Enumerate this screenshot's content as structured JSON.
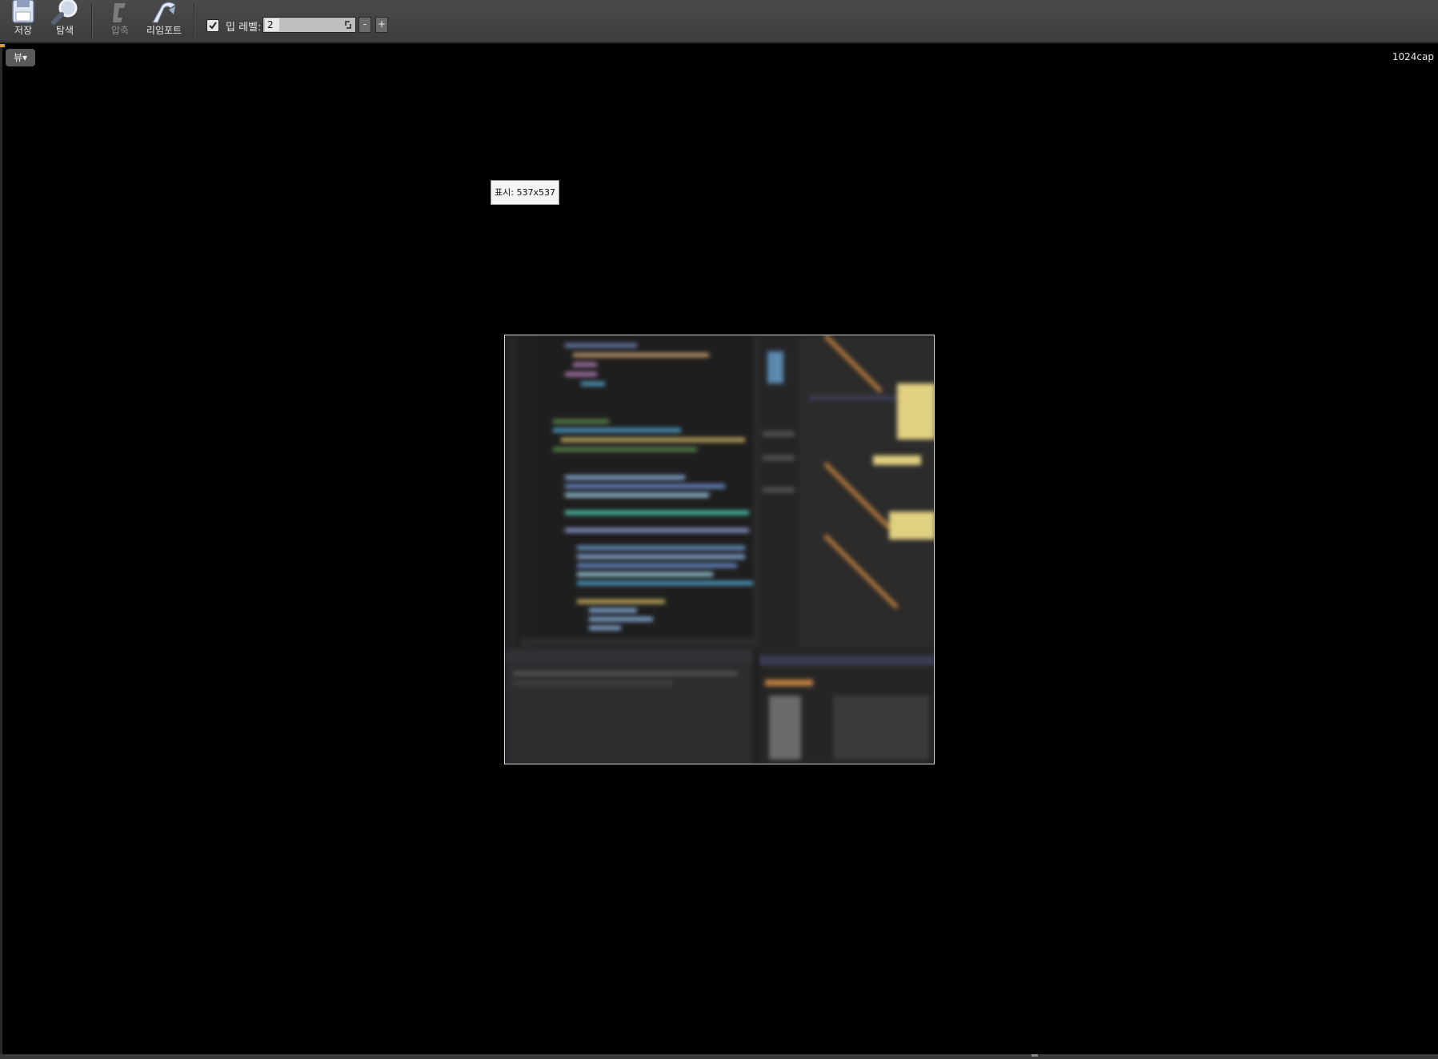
{
  "toolbar": {
    "save_label": "저장",
    "browse_label": "탐색",
    "compress_label": "압축",
    "reimport_label": "리임포트",
    "mip_level": {
      "checked": true,
      "label": "밉 레벨:",
      "value": "2",
      "decrement_label": "-",
      "increment_label": "+"
    }
  },
  "viewport": {
    "view_menu_label": "뷰▾",
    "texture_name": "1024cap",
    "display_info": "표시: 537x537"
  },
  "icons": {
    "save": "floppy-disk-icon",
    "browse": "magnifier-icon",
    "compress": "compress-icon",
    "reimport": "reimport-icon",
    "checkbox": "checkmark-icon",
    "spinner": "spinner-arrows-icon"
  },
  "colors": {
    "toolbar_bg": "#444444",
    "viewport_bg": "#000000",
    "accent": "#d6a21a",
    "texture_border": "#d8d8d8"
  }
}
